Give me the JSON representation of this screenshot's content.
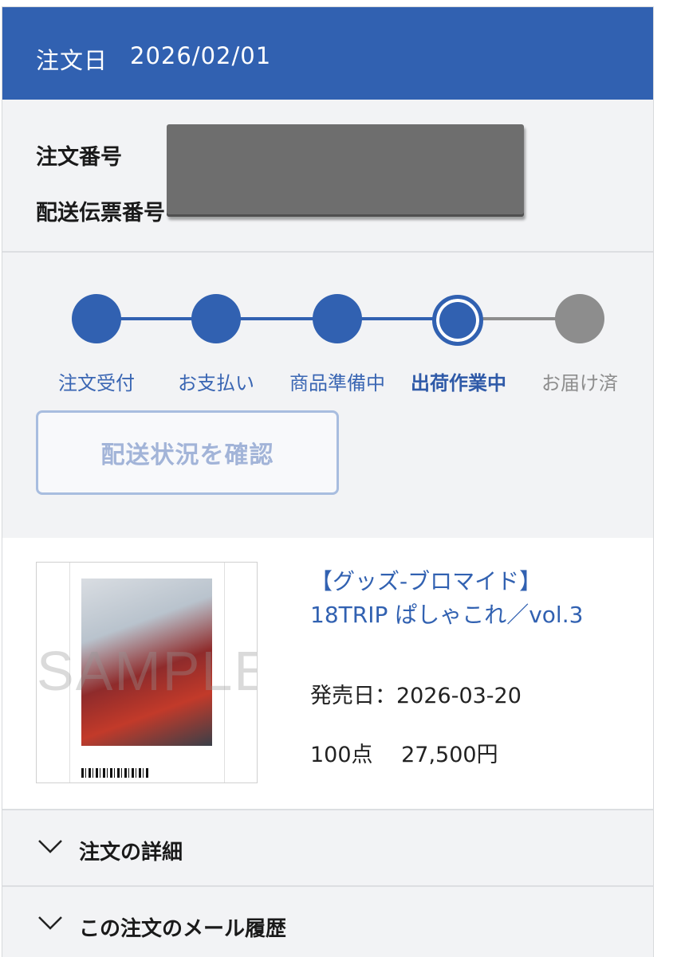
{
  "header": {
    "label": "注文日",
    "date": "2026/02/01"
  },
  "order_info": {
    "number_label": "注文番号",
    "tracking_label": "配送伝票番号"
  },
  "progress": {
    "steps": [
      {
        "label": "注文受付",
        "state": "done"
      },
      {
        "label": "お支払い",
        "state": "done"
      },
      {
        "label": "商品準備中",
        "state": "done"
      },
      {
        "label": "出荷作業中",
        "state": "current"
      },
      {
        "label": "お届け済",
        "state": "pending"
      }
    ],
    "track_button": "配送状況を確認"
  },
  "product": {
    "title_line1": "【グッズ-ブロマイド】",
    "title_line2": "18TRIP ぱしゃこれ／vol.3",
    "release": "発売日：2026-03-20",
    "qty_price": "100点　 27,500円",
    "thumb_watermark": "SAMPLE"
  },
  "accordions": [
    {
      "label": "注文の詳細"
    },
    {
      "label": "この注文のメール履歴"
    }
  ],
  "colors": {
    "accent": "#3161b1",
    "pending": "#8d8d8d",
    "background": "#f2f3f5"
  }
}
